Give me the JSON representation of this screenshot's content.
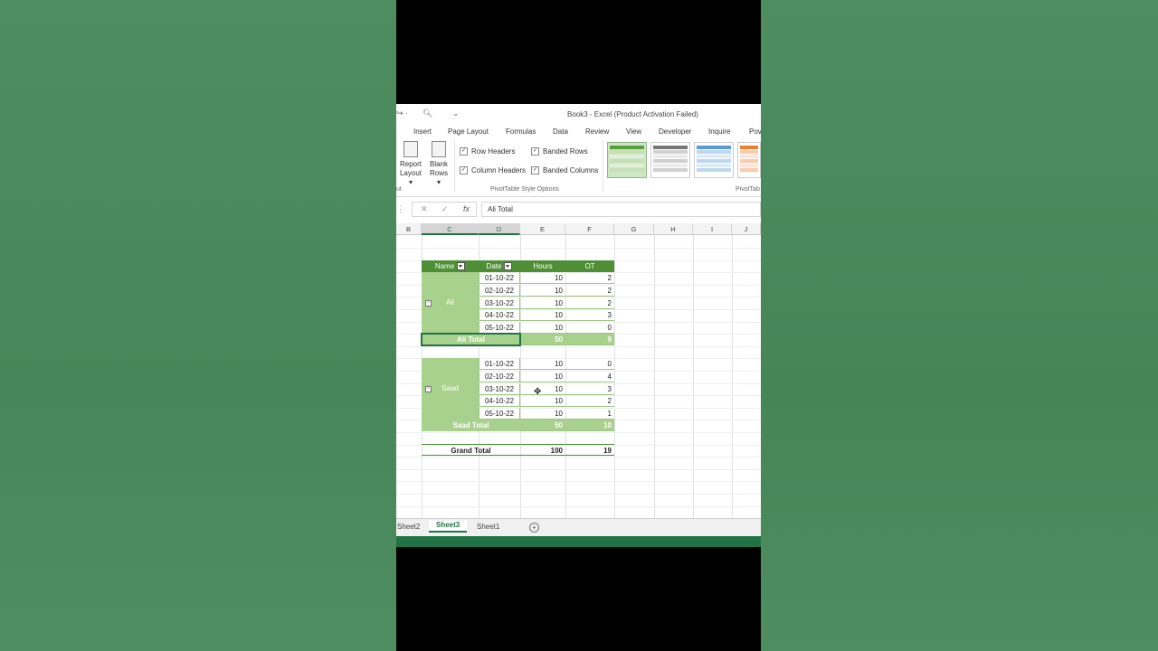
{
  "window": {
    "title": "Book3 - Excel (Product Activation Failed)"
  },
  "ribbon_tabs": [
    "Insert",
    "Page Layout",
    "Formulas",
    "Data",
    "Review",
    "View",
    "Developer",
    "Inquire",
    "Pov"
  ],
  "ribbon": {
    "report_layout": "Report Layout",
    "blank_rows": "Blank Rows",
    "options": {
      "row_headers": "Row Headers",
      "column_headers": "Column Headers",
      "banded_rows": "Banded Rows",
      "banded_columns": "Banded Columns"
    },
    "group_style_options": "PivotTable Style Options",
    "group_styles": "PivotTab",
    "group_left_fragment": "ut"
  },
  "formula_bar": {
    "value": "Ali Total",
    "fx": "fx"
  },
  "columns": [
    "B",
    "C",
    "D",
    "E",
    "F",
    "G",
    "H",
    "I",
    "J"
  ],
  "pivot": {
    "headers": {
      "name": "Name",
      "date": "Date",
      "hours": "Hours",
      "ot": "OT"
    },
    "groups": [
      {
        "name": "Ali",
        "rows": [
          {
            "date": "01-10-22",
            "hours": "10",
            "ot": "2"
          },
          {
            "date": "02-10-22",
            "hours": "10",
            "ot": "2"
          },
          {
            "date": "03-10-22",
            "hours": "10",
            "ot": "2"
          },
          {
            "date": "04-10-22",
            "hours": "10",
            "ot": "3"
          },
          {
            "date": "05-10-22",
            "hours": "10",
            "ot": "0"
          }
        ],
        "total_label": "Ali Total",
        "total_hours": "50",
        "total_ot": "9"
      },
      {
        "name": "Saad",
        "rows": [
          {
            "date": "01-10-22",
            "hours": "10",
            "ot": "0"
          },
          {
            "date": "02-10-22",
            "hours": "10",
            "ot": "4"
          },
          {
            "date": "03-10-22",
            "hours": "10",
            "ot": "3"
          },
          {
            "date": "04-10-22",
            "hours": "10",
            "ot": "2"
          },
          {
            "date": "05-10-22",
            "hours": "10",
            "ot": "1"
          }
        ],
        "total_label": "Saad Total",
        "total_hours": "50",
        "total_ot": "10"
      }
    ],
    "grand": {
      "label": "Grand Total",
      "hours": "100",
      "ot": "19"
    }
  },
  "sheets": [
    "Sheet2",
    "Sheet3",
    "Sheet1"
  ],
  "active_sheet": "Sheet3",
  "colors": {
    "excel_green": "#217346",
    "pivot_header": "#4e8f35",
    "pivot_band": "#a9d18e"
  }
}
